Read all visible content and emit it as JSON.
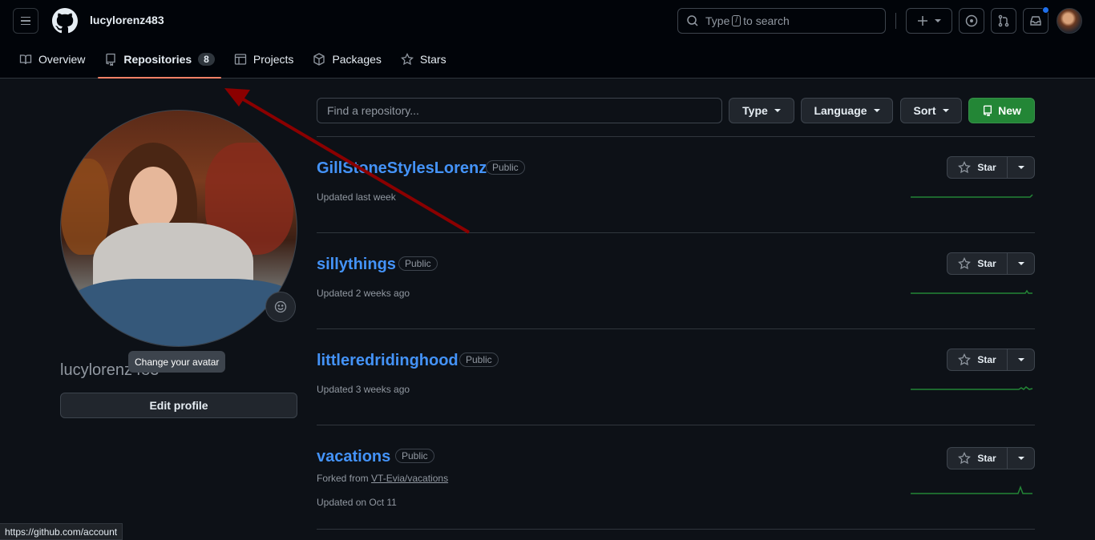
{
  "header": {
    "username": "lucylorenz483",
    "search_prefix": "Type",
    "search_key": "/",
    "search_suffix": "to search",
    "create_label": "+"
  },
  "tabs": [
    {
      "label": "Overview"
    },
    {
      "label": "Repositories",
      "count": "8"
    },
    {
      "label": "Projects"
    },
    {
      "label": "Packages"
    },
    {
      "label": "Stars"
    }
  ],
  "profile": {
    "fullname": "lucylorenz483",
    "tooltip": "Change your avatar",
    "edit_label": "Edit profile"
  },
  "filters": {
    "find_placeholder": "Find a repository...",
    "type_label": "Type",
    "language_label": "Language",
    "sort_label": "Sort",
    "new_label": "New"
  },
  "repos": [
    {
      "name": "GillStoneStylesLorenz",
      "visibility": "Public",
      "updated": "Updated last week",
      "star_label": "Star"
    },
    {
      "name": "sillythings",
      "visibility": "Public",
      "updated": "Updated 2 weeks ago",
      "star_label": "Star"
    },
    {
      "name": "littleredridinghood",
      "visibility": "Public",
      "updated": "Updated 3 weeks ago",
      "star_label": "Star"
    },
    {
      "name": "vacations",
      "visibility": "Public",
      "forked_prefix": "Forked from",
      "forked_from": "VT-Evia/vacations",
      "updated": "Updated on Oct 11",
      "star_label": "Star"
    }
  ],
  "status_url": "https://github.com/account",
  "colors": {
    "accent_link": "#4493f8",
    "new_button": "#238636",
    "tab_underline": "#f78166",
    "annotation_arrow": "#8b0000"
  }
}
